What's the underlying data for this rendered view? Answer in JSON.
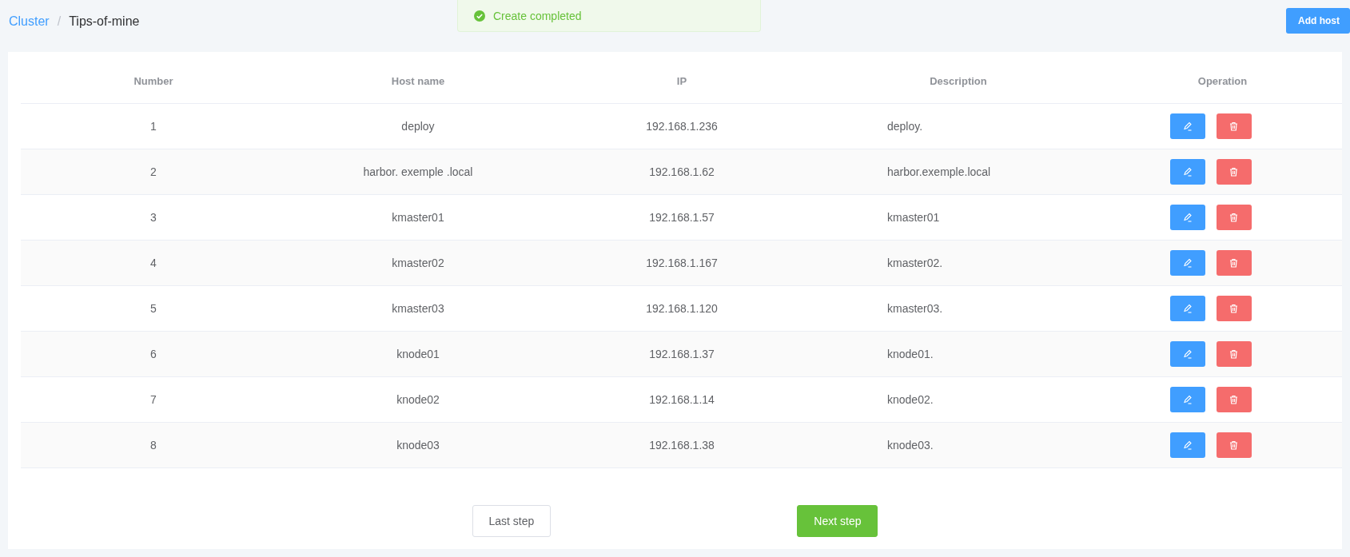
{
  "breadcrumb": [
    {
      "label": "Cluster",
      "kind": "link"
    },
    {
      "label": "Tips-of-mine",
      "kind": "current"
    }
  ],
  "breadcrumb_separator": "/",
  "toast": {
    "message": "Create completed",
    "kind": "success"
  },
  "add_button": "Add host",
  "table": {
    "columns": [
      "Number",
      "Host name",
      "IP",
      "Description",
      "Operation"
    ],
    "rows": [
      {
        "number": "1",
        "host": "deploy",
        "ip": "192.168.1.236",
        "description": "deploy."
      },
      {
        "number": "2",
        "host": "harbor. exemple .local",
        "ip": "192.168.1.62",
        "description": "harbor.exemple.local"
      },
      {
        "number": "3",
        "host": "kmaster01",
        "ip": "192.168.1.57",
        "description": "kmaster01"
      },
      {
        "number": "4",
        "host": "kmaster02",
        "ip": "192.168.1.167",
        "description": "kmaster02."
      },
      {
        "number": "5",
        "host": "kmaster03",
        "ip": "192.168.1.120",
        "description": "kmaster03."
      },
      {
        "number": "6",
        "host": "knode01",
        "ip": "192.168.1.37",
        "description": "knode01."
      },
      {
        "number": "7",
        "host": "knode02",
        "ip": "192.168.1.14",
        "description": "knode02."
      },
      {
        "number": "8",
        "host": "knode03",
        "ip": "192.168.1.38",
        "description": "knode03."
      }
    ]
  },
  "footer_buttons": [
    {
      "label": "Last step",
      "kind": "default"
    },
    {
      "label": "Next step",
      "kind": "primary"
    }
  ]
}
